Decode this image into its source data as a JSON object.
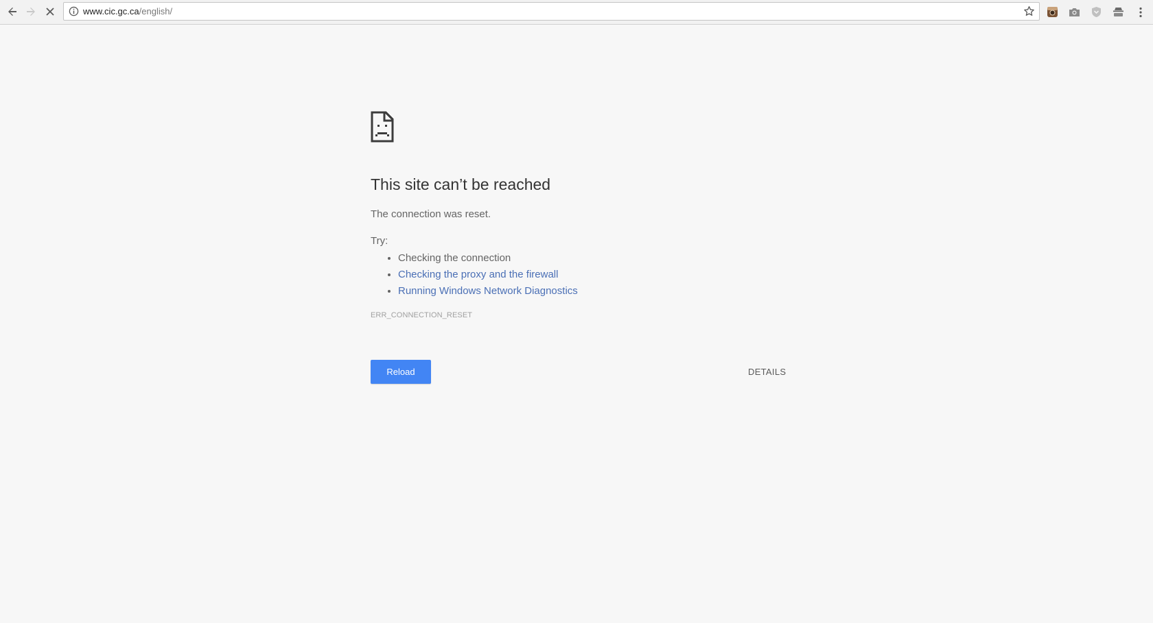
{
  "browser": {
    "url_host": "www.cic.gc.ca",
    "url_path": "/english/",
    "back_icon": "arrow-left-icon",
    "forward_icon": "arrow-right-icon",
    "stop_icon": "close-icon",
    "extensions": [
      "instagram-extension-icon",
      "camera-icon",
      "shield-icon",
      "incognito-icon",
      "more-vert-icon"
    ]
  },
  "error": {
    "icon": "sad-document-icon",
    "title": "This site can’t be reached",
    "reason": "The connection was reset.",
    "try_label": "Try:",
    "suggestions": [
      {
        "text": "Checking the connection",
        "link": false
      },
      {
        "text": "Checking the proxy and the firewall",
        "link": true
      },
      {
        "text": "Running Windows Network Diagnostics",
        "link": true
      }
    ],
    "code": "ERR_CONNECTION_RESET",
    "reload_label": "Reload",
    "details_label": "DETAILS"
  },
  "colors": {
    "background": "#f7f7f7",
    "reload_button": "#4285f4",
    "link": "#4a6fb5"
  }
}
